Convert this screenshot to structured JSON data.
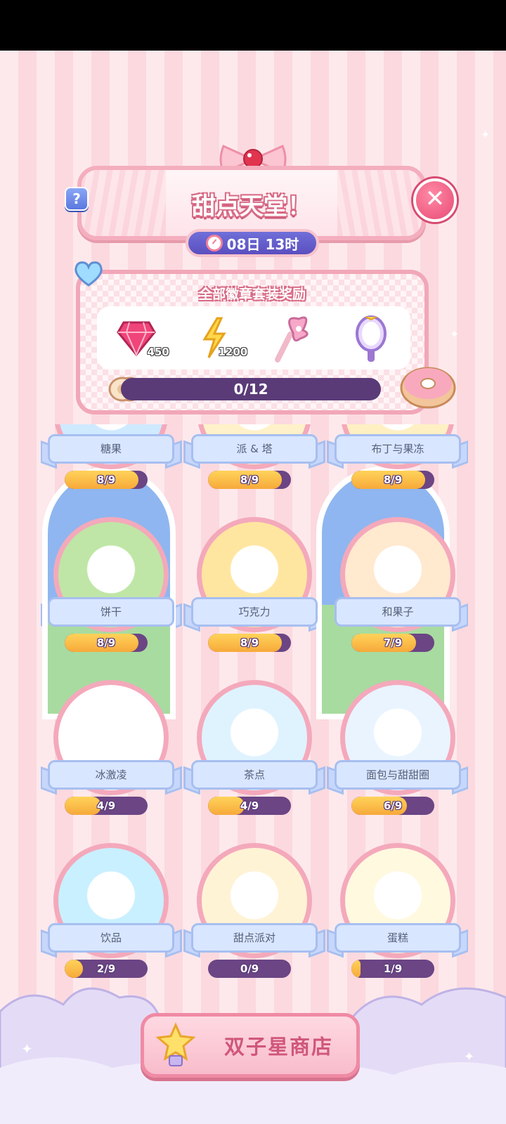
{
  "header": {
    "title": "甜点天堂！",
    "timer": "08日 13时",
    "help_label": "?",
    "close_label": "✕"
  },
  "rewards": {
    "title": "全部徽章套装奖励",
    "items": [
      {
        "icon": "gem-icon",
        "qty": "450"
      },
      {
        "icon": "lightning-ticket-icon",
        "qty": "1200"
      },
      {
        "icon": "butterfly-wand-icon",
        "qty": ""
      },
      {
        "icon": "mirror-icon",
        "qty": ""
      }
    ],
    "progress_text": "0/12",
    "progress": 0
  },
  "categories": [
    {
      "label": "糖果",
      "progress_text": "8/9",
      "value": 8,
      "max": 9
    },
    {
      "label": "派 & 塔",
      "progress_text": "8/9",
      "value": 8,
      "max": 9
    },
    {
      "label": "布丁与果冻",
      "progress_text": "8/9",
      "value": 8,
      "max": 9
    },
    {
      "label": "饼干",
      "progress_text": "8/9",
      "value": 8,
      "max": 9
    },
    {
      "label": "巧克力",
      "progress_text": "8/9",
      "value": 8,
      "max": 9
    },
    {
      "label": "和果子",
      "progress_text": "7/9",
      "value": 7,
      "max": 9
    },
    {
      "label": "冰激凌",
      "progress_text": "4/9",
      "value": 4,
      "max": 9
    },
    {
      "label": "茶点",
      "progress_text": "4/9",
      "value": 4,
      "max": 9
    },
    {
      "label": "面包与甜甜圈",
      "progress_text": "6/9",
      "value": 6,
      "max": 9
    },
    {
      "label": "饮品",
      "progress_text": "2/9",
      "value": 2,
      "max": 9
    },
    {
      "label": "甜点派对",
      "progress_text": "0/9",
      "value": 0,
      "max": 9
    },
    {
      "label": "蛋糕",
      "progress_text": "1/9",
      "value": 1,
      "max": 9
    }
  ],
  "shop": {
    "label": "双子星商店",
    "icon": "star-lantern-icon"
  },
  "colors": {
    "accent": "#f4a9bb",
    "bar_track": "#6b4584",
    "bar_fill": "#f7a93a",
    "ribbon": "#d9e6ff"
  }
}
